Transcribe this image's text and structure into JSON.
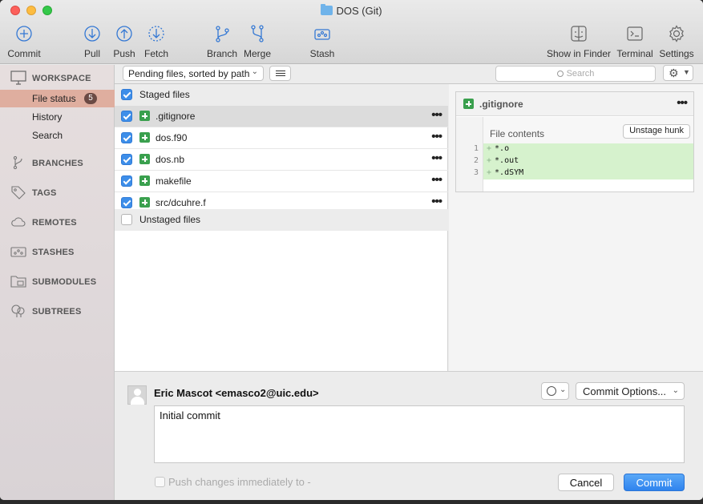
{
  "window": {
    "title": "DOS (Git)"
  },
  "toolbar": {
    "commit": "Commit",
    "pull": "Pull",
    "push": "Push",
    "fetch": "Fetch",
    "branch": "Branch",
    "merge": "Merge",
    "stash": "Stash",
    "show_in_finder": "Show in Finder",
    "terminal": "Terminal",
    "settings": "Settings"
  },
  "sidebar": {
    "workspace": "WORKSPACE",
    "file_status": "File status",
    "file_status_count": "5",
    "history": "History",
    "search": "Search",
    "branches": "BRANCHES",
    "tags": "TAGS",
    "remotes": "REMOTES",
    "stashes": "STASHES",
    "submodules": "SUBMODULES",
    "subtrees": "SUBTREES"
  },
  "filebar": {
    "sort": "Pending files, sorted by path",
    "search_placeholder": "Search"
  },
  "files": {
    "staged_label": "Staged files",
    "staged": [
      {
        "name": ".gitignore"
      },
      {
        "name": "dos.f90"
      },
      {
        "name": "dos.nb"
      },
      {
        "name": "makefile"
      },
      {
        "name": "src/dcuhre.f"
      }
    ],
    "unstaged_label": "Unstaged files"
  },
  "diff": {
    "file": ".gitignore",
    "hunk_label": "File contents",
    "unstage_hunk": "Unstage hunk",
    "lines": [
      {
        "num": "1",
        "marker": "+",
        "text": "*.o"
      },
      {
        "num": "2",
        "marker": "+",
        "text": "*.out"
      },
      {
        "num": "3",
        "marker": "+",
        "text": "*.dSYM"
      }
    ]
  },
  "commit": {
    "author": "Eric Mascot <emasco2@uic.edu>",
    "options": "Commit Options...",
    "message": "Initial commit",
    "push_label": "Push changes immediately to -",
    "cancel": "Cancel",
    "commit": "Commit"
  },
  "colors": {
    "accent": "#3d8ee9",
    "added": "#3aa04e",
    "selection": "#dfae9f"
  }
}
